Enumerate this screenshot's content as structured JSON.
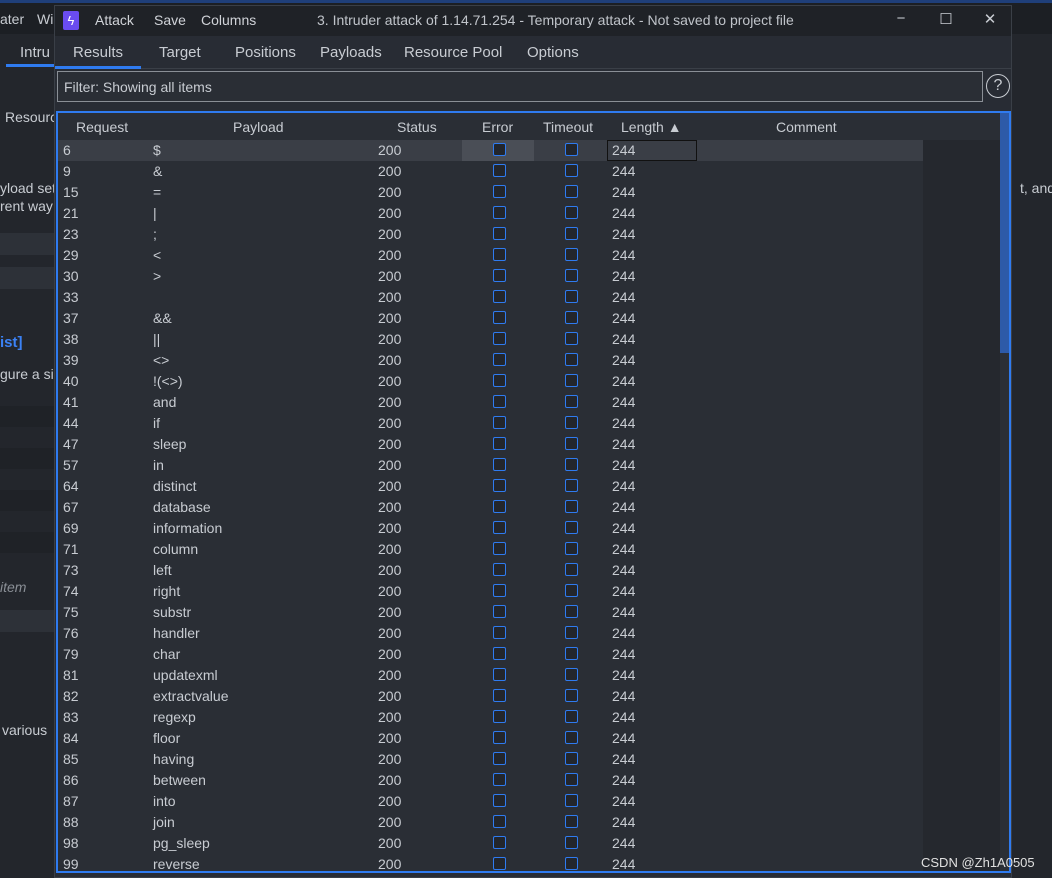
{
  "background": {
    "menu_fragments": [
      "ater",
      "Wi"
    ],
    "tab_fragment": "Intru",
    "subtab_fragment": "Resourc",
    "text_fragments": [
      "yload set",
      "rent way",
      "ist]",
      "gure a si",
      "item",
      "various"
    ],
    "right_fragment": "t, and"
  },
  "window": {
    "menu": [
      "Attack",
      "Save",
      "Columns"
    ],
    "title": "3. Intruder attack of 1.14.71.254 - Temporary attack - Not saved to project file",
    "controls": {
      "minimize": "−",
      "maximize": "☐",
      "close": "✕"
    }
  },
  "tabs": [
    {
      "label": "Results",
      "active": true
    },
    {
      "label": "Target"
    },
    {
      "label": "Positions"
    },
    {
      "label": "Payloads"
    },
    {
      "label": "Resource Pool"
    },
    {
      "label": "Options"
    }
  ],
  "filter": {
    "text": "Filter: Showing all items",
    "help": "?"
  },
  "table": {
    "columns": [
      "Request",
      "Payload",
      "Status",
      "Error",
      "Timeout",
      "Length ▲",
      "Comment"
    ],
    "sort": {
      "column": "Length",
      "direction": "ascending"
    },
    "rows": [
      [
        "6",
        "$",
        "200",
        "244"
      ],
      [
        "9",
        "&",
        "200",
        "244"
      ],
      [
        "15",
        "=",
        "200",
        "244"
      ],
      [
        "21",
        "|",
        "200",
        "244"
      ],
      [
        "23",
        ";",
        "200",
        "244"
      ],
      [
        "29",
        "<",
        "200",
        "244"
      ],
      [
        "30",
        ">",
        "200",
        "244"
      ],
      [
        "33",
        "",
        "200",
        "244"
      ],
      [
        "37",
        "&&",
        "200",
        "244"
      ],
      [
        "38",
        "||",
        "200",
        "244"
      ],
      [
        "39",
        "<>",
        "200",
        "244"
      ],
      [
        "40",
        "!(<>)",
        "200",
        "244"
      ],
      [
        "41",
        "and",
        "200",
        "244"
      ],
      [
        "44",
        "if",
        "200",
        "244"
      ],
      [
        "47",
        "sleep",
        "200",
        "244"
      ],
      [
        "57",
        "in",
        "200",
        "244"
      ],
      [
        "64",
        "distinct",
        "200",
        "244"
      ],
      [
        "67",
        "database",
        "200",
        "244"
      ],
      [
        "69",
        "information",
        "200",
        "244"
      ],
      [
        "71",
        "column",
        "200",
        "244"
      ],
      [
        "73",
        "left",
        "200",
        "244"
      ],
      [
        "74",
        "right",
        "200",
        "244"
      ],
      [
        "75",
        "substr",
        "200",
        "244"
      ],
      [
        "76",
        "handler",
        "200",
        "244"
      ],
      [
        "79",
        "char",
        "200",
        "244"
      ],
      [
        "81",
        "updatexml",
        "200",
        "244"
      ],
      [
        "82",
        "extractvalue",
        "200",
        "244"
      ],
      [
        "83",
        "regexp",
        "200",
        "244"
      ],
      [
        "84",
        "floor",
        "200",
        "244"
      ],
      [
        "85",
        "having",
        "200",
        "244"
      ],
      [
        "86",
        "between",
        "200",
        "244"
      ],
      [
        "87",
        "into",
        "200",
        "244"
      ],
      [
        "88",
        "join",
        "200",
        "244"
      ],
      [
        "98",
        "pg_sleep",
        "200",
        "244"
      ],
      [
        "99",
        "reverse",
        "200",
        "244"
      ]
    ]
  },
  "watermark": "CSDN @Zh1A0505",
  "colors": {
    "accent": "#2f7bf0",
    "window_bg": "#282c34",
    "selected_row": "#3a3e46"
  }
}
